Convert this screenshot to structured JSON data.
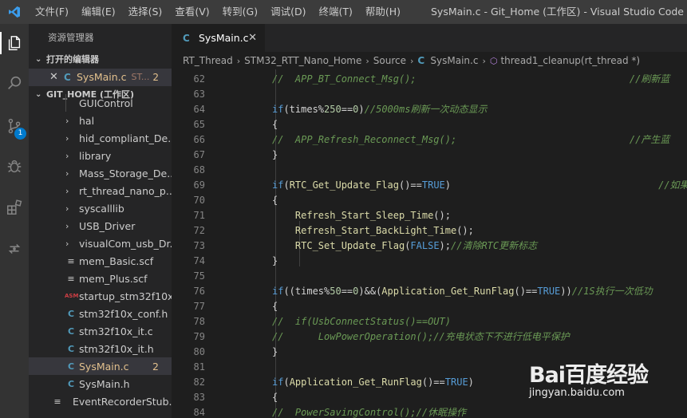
{
  "titlebar": {
    "menu": [
      "文件(F)",
      "编辑(E)",
      "选择(S)",
      "查看(V)",
      "转到(G)",
      "调试(D)",
      "终端(T)",
      "帮助(H)"
    ],
    "window_title": "SysMain.c - Git_Home (工作区) - Visual Studio Code"
  },
  "activity_bar": {
    "icons": [
      "explorer-icon",
      "search-icon",
      "source-control-icon",
      "debug-icon",
      "extensions-icon",
      "remote-icon"
    ],
    "source_control_badge": "1"
  },
  "sidebar": {
    "title": "资源管理器",
    "open_editors_header": "打开的编辑器",
    "open_editor": {
      "name": "SysMain.c",
      "path": "ST...",
      "count": "2"
    },
    "workspace_header": "GIT_HOME (工作区)",
    "tree": [
      {
        "label": "GUIControl",
        "type": "folder"
      },
      {
        "label": "hal",
        "type": "folder"
      },
      {
        "label": "hid_compliant_De...",
        "type": "folder"
      },
      {
        "label": "library",
        "type": "folder"
      },
      {
        "label": "Mass_Storage_De...",
        "type": "folder"
      },
      {
        "label": "rt_thread_nano_p...",
        "type": "folder"
      },
      {
        "label": "syscalllib",
        "type": "folder"
      },
      {
        "label": "USB_Driver",
        "type": "folder"
      },
      {
        "label": "visualCom_usb_Dr...",
        "type": "folder"
      },
      {
        "label": "mem_Basic.scf",
        "type": "scf"
      },
      {
        "label": "mem_Plus.scf",
        "type": "scf"
      },
      {
        "label": "startup_stm32f10x...",
        "type": "asm"
      },
      {
        "label": "stm32f10x_conf.h",
        "type": "c"
      },
      {
        "label": "stm32f10x_it.c",
        "type": "c"
      },
      {
        "label": "stm32f10x_it.h",
        "type": "c"
      },
      {
        "label": "SysMain.c",
        "type": "c",
        "selected": true,
        "count": "2"
      },
      {
        "label": "SysMain.h",
        "type": "c"
      },
      {
        "label": "EventRecorderStub....",
        "type": "scf"
      }
    ]
  },
  "editor": {
    "tab_label": "SysMain.c",
    "breadcrumb": [
      "RT_Thread",
      "STM32_RTT_Nano_Home",
      "Source",
      "SysMain.c",
      "thread1_cleanup(rt_thread *)"
    ],
    "lines": [
      {
        "n": "62",
        "tokens": [
          [
            "cm",
            "//  APP_BT_Connect_Msg();                                     //刷新蓝"
          ]
        ]
      },
      {
        "n": "63",
        "tokens": []
      },
      {
        "n": "64",
        "tokens": [
          [
            "kw",
            "if"
          ],
          [
            "op",
            "(times%"
          ],
          [
            "num",
            "250"
          ],
          [
            "op",
            "=="
          ],
          [
            "num",
            "0"
          ],
          [
            "op",
            ")"
          ],
          [
            "cm",
            "//5000ms刷新一次动态显示"
          ]
        ]
      },
      {
        "n": "65",
        "tokens": [
          [
            "op",
            "{"
          ]
        ]
      },
      {
        "n": "66",
        "tokens": [
          [
            "cm",
            "//  APP_Refresh_Reconnect_Msg();                              //产生蓝"
          ]
        ]
      },
      {
        "n": "67",
        "tokens": [
          [
            "op",
            "}"
          ]
        ]
      },
      {
        "n": "68",
        "tokens": []
      },
      {
        "n": "69",
        "tokens": [
          [
            "kw",
            "if"
          ],
          [
            "op",
            "("
          ],
          [
            "fn",
            "RTC_Get_Update_Flag"
          ],
          [
            "op",
            "()=="
          ],
          [
            "cst",
            "TRUE"
          ],
          [
            "op",
            ")                                    "
          ],
          [
            "cm",
            "//如果蓝"
          ]
        ]
      },
      {
        "n": "70",
        "tokens": [
          [
            "op",
            "{"
          ]
        ]
      },
      {
        "n": "71",
        "tokens": [
          [
            "op",
            "    "
          ],
          [
            "fn",
            "Refresh_Start_Sleep_Time"
          ],
          [
            "op",
            "();"
          ]
        ]
      },
      {
        "n": "72",
        "tokens": [
          [
            "op",
            "    "
          ],
          [
            "fn",
            "Refresh_Start_BackLight_Time"
          ],
          [
            "op",
            "();"
          ]
        ]
      },
      {
        "n": "73",
        "tokens": [
          [
            "op",
            "    "
          ],
          [
            "fn",
            "RTC_Set_Update_Flag"
          ],
          [
            "op",
            "("
          ],
          [
            "cst",
            "FALSE"
          ],
          [
            "op",
            ");"
          ],
          [
            "cm",
            "//清除RTC更新标志"
          ]
        ]
      },
      {
        "n": "74",
        "tokens": [
          [
            "op",
            "}"
          ]
        ]
      },
      {
        "n": "75",
        "tokens": []
      },
      {
        "n": "76",
        "tokens": [
          [
            "kw",
            "if"
          ],
          [
            "op",
            "((times%"
          ],
          [
            "num",
            "50"
          ],
          [
            "op",
            "=="
          ],
          [
            "num",
            "0"
          ],
          [
            "op",
            ")&&("
          ],
          [
            "fn",
            "Application_Get_RunFlag"
          ],
          [
            "op",
            "()=="
          ],
          [
            "cst",
            "TRUE"
          ],
          [
            "op",
            "))"
          ],
          [
            "cm",
            "//1S执行一次低功"
          ]
        ]
      },
      {
        "n": "77",
        "tokens": [
          [
            "op",
            "{"
          ]
        ]
      },
      {
        "n": "78",
        "tokens": [
          [
            "cm",
            "//  if(UsbConnectStatus()==OUT)"
          ]
        ]
      },
      {
        "n": "79",
        "tokens": [
          [
            "cm",
            "//      LowPowerOperation();//充电状态下不进行低电平保护"
          ]
        ]
      },
      {
        "n": "80",
        "tokens": [
          [
            "op",
            "}"
          ]
        ]
      },
      {
        "n": "81",
        "tokens": []
      },
      {
        "n": "82",
        "tokens": [
          [
            "kw",
            "if"
          ],
          [
            "op",
            "("
          ],
          [
            "fn",
            "Application_Get_RunFlag"
          ],
          [
            "op",
            "()=="
          ],
          [
            "cst",
            "TRUE"
          ],
          [
            "op",
            ")"
          ]
        ]
      },
      {
        "n": "83",
        "tokens": [
          [
            "op",
            "{"
          ]
        ]
      },
      {
        "n": "84",
        "tokens": [
          [
            "cm",
            "//  PowerSavingControl();//休眠操作"
          ]
        ]
      }
    ]
  },
  "watermark": {
    "logo": "Bai百度经验",
    "sub": "jingyan.baidu.com"
  }
}
